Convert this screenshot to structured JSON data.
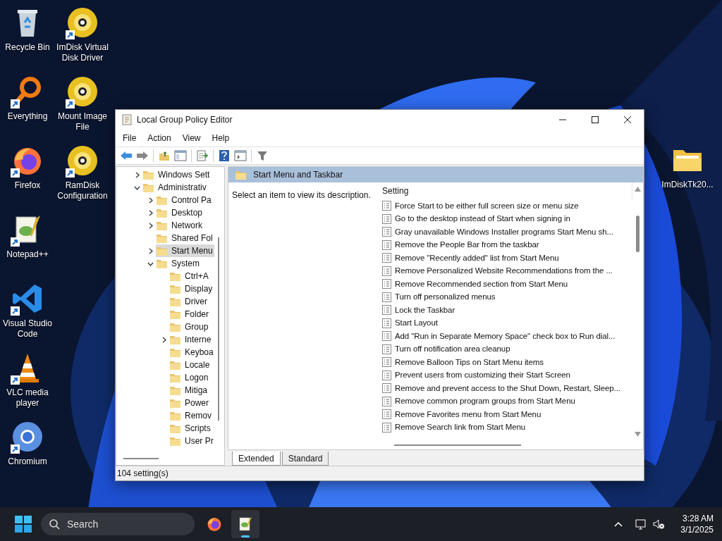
{
  "desktop": {
    "columns": [
      [
        {
          "label": "Recycle Bin",
          "kind": "recycle",
          "shortcut": false
        },
        {
          "label": "Everything",
          "kind": "magnifier",
          "shortcut": true
        },
        {
          "label": "Firefox",
          "kind": "firefox",
          "shortcut": true
        },
        {
          "label": "Notepad++",
          "kind": "notepad",
          "shortcut": true
        },
        {
          "label": "Visual Studio Code",
          "kind": "vscode",
          "shortcut": true
        },
        {
          "label": "VLC media player",
          "kind": "cone",
          "shortcut": true
        },
        {
          "label": "Chromium",
          "kind": "chromium",
          "shortcut": true
        }
      ],
      [
        {
          "label": "ImDisk Virtual Disk Driver",
          "kind": "disc",
          "shortcut": true
        },
        {
          "label": "Mount Image File",
          "kind": "disc",
          "shortcut": true
        },
        {
          "label": "RamDisk Configuration",
          "kind": "disc",
          "shortcut": true
        }
      ],
      [
        {
          "label": "ImDiskTk20...",
          "kind": "folder",
          "shortcut": false
        }
      ]
    ]
  },
  "window": {
    "title": "Local Group Policy Editor",
    "menu": [
      "File",
      "Action",
      "View",
      "Help"
    ],
    "tree": [
      {
        "label": "Windows Sett",
        "kind": "collapsed",
        "selected": false
      },
      {
        "label": "Administrativ",
        "kind": "expanded",
        "selected": false,
        "children": [
          {
            "label": "Control Pa",
            "kind": "collapsed",
            "selected": false
          },
          {
            "label": "Desktop",
            "kind": "collapsed",
            "selected": false
          },
          {
            "label": "Network",
            "kind": "collapsed",
            "selected": false
          },
          {
            "label": "Shared Fol",
            "kind": "leaf",
            "selected": false
          },
          {
            "label": "Start Menu",
            "kind": "collapsed",
            "selected": true
          },
          {
            "label": "System",
            "kind": "expanded",
            "selected": false,
            "children": [
              {
                "label": "Ctrl+A",
                "kind": "leaf",
                "selected": false
              },
              {
                "label": "Display",
                "kind": "leaf",
                "selected": false
              },
              {
                "label": "Driver",
                "kind": "leaf",
                "selected": false
              },
              {
                "label": "Folder",
                "kind": "leaf",
                "selected": false
              },
              {
                "label": "Group",
                "kind": "leaf",
                "selected": false
              },
              {
                "label": "Interne",
                "kind": "collapsed",
                "selected": false
              },
              {
                "label": "Keyboa",
                "kind": "leaf",
                "selected": false
              },
              {
                "label": "Locale",
                "kind": "leaf",
                "selected": false
              },
              {
                "label": "Logon",
                "kind": "leaf",
                "selected": false
              },
              {
                "label": "Mitiga",
                "kind": "leaf",
                "selected": false
              },
              {
                "label": "Power",
                "kind": "leaf",
                "selected": false
              },
              {
                "label": "Remov",
                "kind": "leaf",
                "selected": false
              },
              {
                "label": "Scripts",
                "kind": "leaf",
                "selected": false
              },
              {
                "label": "User Pr",
                "kind": "leaf",
                "selected": false
              }
            ]
          }
        ]
      }
    ],
    "header": "Start Menu and Taskbar",
    "description": "Select an item to view its description.",
    "column": "Setting",
    "settings": [
      "Force Start to be either full screen size or menu size",
      "Go to the desktop instead of Start when signing in",
      "Gray unavailable Windows Installer programs Start Menu sh...",
      "Remove the People Bar from the taskbar",
      "Remove \"Recently added\" list from Start Menu",
      "Remove Personalized Website Recommendations from the ...",
      "Remove Recommended section from Start Menu",
      "Turn off personalized menus",
      "Lock the Taskbar",
      "Start Layout",
      "Add \"Run in Separate Memory Space\" check box to Run dial...",
      "Turn off notification area cleanup",
      "Remove Balloon Tips on Start Menu items",
      "Prevent users from customizing their Start Screen",
      "Remove and prevent access to the Shut Down, Restart, Sleep...",
      "Remove common program groups from Start Menu",
      "Remove Favorites menu from Start Menu",
      "Remove Search link from Start Menu"
    ],
    "tabs": [
      {
        "label": "Extended",
        "selected": true
      },
      {
        "label": "Standard",
        "selected": false
      }
    ],
    "status_bar": "104 setting(s)"
  },
  "taskbar": {
    "search_placeholder": "Search",
    "apps": [
      {
        "kind": "firefox",
        "selected": false
      },
      {
        "kind": "notepad",
        "selected": true
      }
    ],
    "time": "3:28 AM",
    "date": "3/1/2025"
  }
}
